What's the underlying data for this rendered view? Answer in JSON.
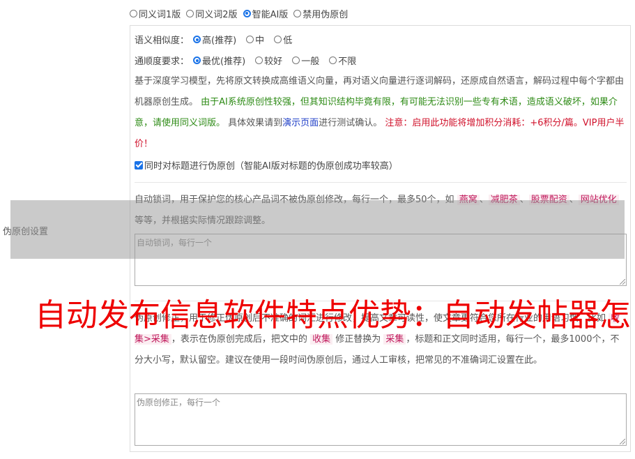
{
  "modes": {
    "options": [
      "同义词1版",
      "同义词2版",
      "智能AI版",
      "禁用伪原创"
    ],
    "selected": "智能AI版"
  },
  "similarity": {
    "label": "语义相似度：",
    "options": [
      "高(推荐)",
      "中",
      "低"
    ],
    "selected": "高(推荐)"
  },
  "fluency": {
    "label": "通顺度要求：",
    "options": [
      "最优(推荐)",
      "较好",
      "一般",
      "不限"
    ],
    "selected": "最优(推荐)"
  },
  "description": {
    "intro": "基于深度学习模型，先将原文转换成高维语义向量，再对语义向量进行逐词解码，还原成自然语言，解码过程中每个字都由机器原创生成。",
    "warning_green": "由于AI系统原创性较强，但其知识结构毕竟有限，有可能无法识别一些专有术语，造成语义破坏，如果介意，请使用同义词版。",
    "test_prefix": "具体效果请到",
    "demo_link": "演示页面",
    "test_suffix": "进行测试确认。",
    "notice_red": "注意：启用此功能将增加积分消耗：+6积分/篇。VIP用户半价！"
  },
  "title_checkbox": {
    "label": "同时对标题进行伪原创（智能AI版对标题的伪原创成功率较高）",
    "checked": true
  },
  "lock_words": {
    "desc_prefix": "自动锁词，用于保护您的核心产品词不被伪原创修改，每行一个，最多50个，如",
    "examples": [
      "燕窝",
      "减肥茶",
      "股票配资",
      "网站优化"
    ],
    "desc_suffix": "等等，并根据实际情况跟踪调整。",
    "placeholder": "自动锁词，每行一个"
  },
  "correction": {
    "desc_prefix": "伪原创修正，用于修正伪原创后不准确的词汇进行修改，提高文章可读性，使文章更符合您所在行业的用语习惯。比如",
    "example_rule": "收集>采集",
    "desc_mid1": "，表示在伪原创完成后，把文中的",
    "example_from": "收集",
    "desc_mid2": "修正替换为",
    "example_to": "采集",
    "desc_suffix": "，标题和正文同时适用，每行一个，最多1000个，不分大小写，默认留空。建议在使用一段时间伪原创后，通过人工审核，把常见的不准确词汇设置在此。",
    "placeholder": "伪原创修正，每行一个"
  },
  "side_label": "伪原创设置",
  "overlay_headline": "自动发布信息软件特点优势：自动发帖器怎",
  "colors": {
    "accent": "#1a73e8",
    "green": "#2e8b16",
    "red": "#d0102a",
    "link": "#1f3fc7",
    "headline": "#ee0000"
  }
}
